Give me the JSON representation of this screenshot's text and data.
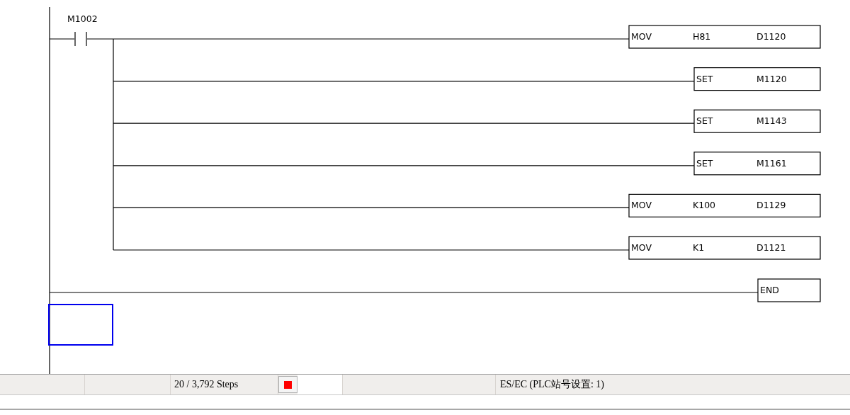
{
  "rungs": [
    {
      "contact": {
        "label": "M1002"
      },
      "instructions": [
        {
          "kind": "mov",
          "op": "MOV",
          "args": [
            "H81",
            "D1120"
          ]
        },
        {
          "kind": "set",
          "op": "SET",
          "args": [
            "M1120"
          ]
        },
        {
          "kind": "set",
          "op": "SET",
          "args": [
            "M1143"
          ]
        },
        {
          "kind": "set",
          "op": "SET",
          "args": [
            "M1161"
          ]
        },
        {
          "kind": "mov",
          "op": "MOV",
          "args": [
            "K100",
            "D1129"
          ]
        },
        {
          "kind": "mov",
          "op": "MOV",
          "args": [
            "K1",
            "D1121"
          ]
        }
      ]
    },
    {
      "instructions": [
        {
          "kind": "end",
          "op": "END"
        }
      ]
    }
  ],
  "cursor": {
    "shown": true
  },
  "status_bar": {
    "steps": "20 / 3,792 Steps",
    "light": {
      "color": "#ff0000"
    },
    "station": "ES/EC (PLC站号设置: 1)"
  }
}
